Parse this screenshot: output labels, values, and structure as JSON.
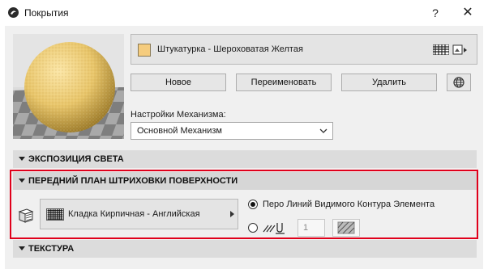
{
  "window": {
    "title": "Покрытия",
    "help_label": "?",
    "close_label": "✕"
  },
  "material": {
    "name": "Штукатурка - Шероховатая Желтая",
    "swatch_color": "#f5cc7e"
  },
  "buttons": {
    "new": "Новое",
    "rename": "Переименовать",
    "delete": "Удалить"
  },
  "engine": {
    "label": "Настройки Механизма:",
    "value": "Основной Механизм"
  },
  "sections": {
    "light": "ЭКСПОЗИЦИЯ СВЕТА",
    "surface": "ПЕРЕДНИЙ ПЛАН ШТРИХОВКИ ПОВЕРХНОСТИ",
    "texture": "ТЕКСТУРА"
  },
  "surface": {
    "fill_name": "Кладка Кирпичная - Английская",
    "option_contour_label": "Перо Линий Видимого Контура Элемента",
    "pen_number": "1"
  },
  "colors": {
    "highlight": "#e0001b",
    "sphere": "#e8c56a"
  }
}
